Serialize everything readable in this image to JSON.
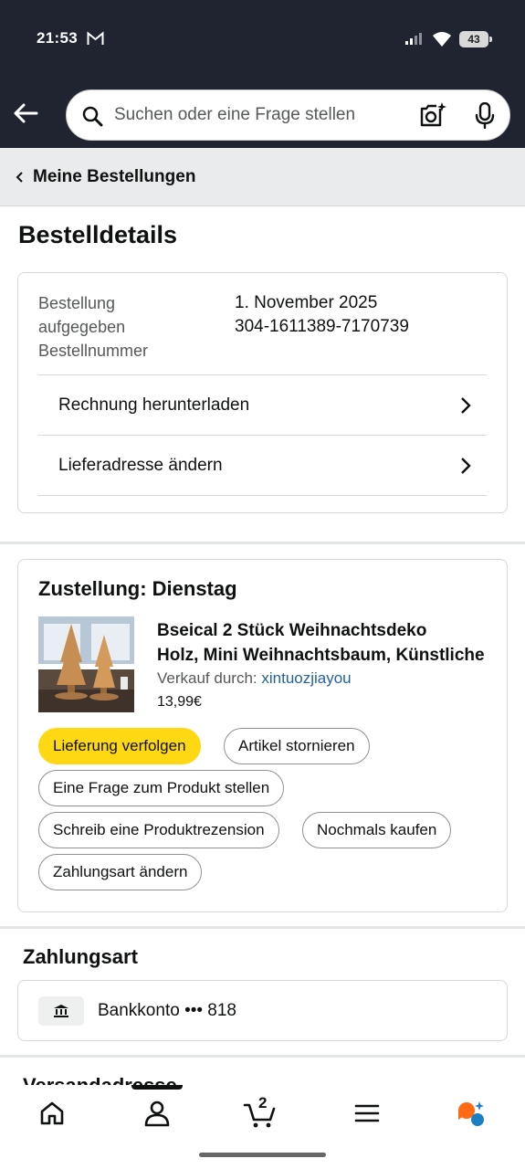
{
  "status_bar": {
    "time": "21:53",
    "battery": "43"
  },
  "search": {
    "placeholder": "Suchen oder eine Frage stellen"
  },
  "breadcrumb": {
    "label": "Meine Bestellungen"
  },
  "page": {
    "title": "Bestelldetails"
  },
  "order": {
    "labels": [
      "Bestellung",
      "aufgegeben",
      "Bestellnummer"
    ],
    "date": "1. November 2025",
    "number": "304-1611389-7170739",
    "links": [
      "Rechnung herunterladen",
      "Lieferadresse ändern"
    ]
  },
  "delivery": {
    "title": "Zustellung: Dienstag",
    "product": {
      "title_line1": "Bseical 2 Stück Weihnachtsdeko",
      "title_line2": "Holz, Mini Weihnachtsbaum, Künstliche",
      "seller_prefix": "Verkauf durch:",
      "seller": "xintuozjiayou",
      "price": "13,99€"
    },
    "actions": [
      "Lieferung verfolgen",
      "Artikel stornieren",
      "Eine Frage zum Produkt stellen",
      "Schreib eine Produktrezension",
      "Nochmals kaufen",
      "Zahlungsart ändern"
    ]
  },
  "payment": {
    "heading": "Zahlungsart",
    "method": "Bankkonto ••• 818"
  },
  "shipping": {
    "heading": "Versandadresse"
  },
  "nav": {
    "cart_count": "2"
  },
  "colors": {
    "header": "#1f2430",
    "accent_yellow": "#ffd814",
    "link": "#2162a1",
    "assistant": "#ff6a13"
  }
}
